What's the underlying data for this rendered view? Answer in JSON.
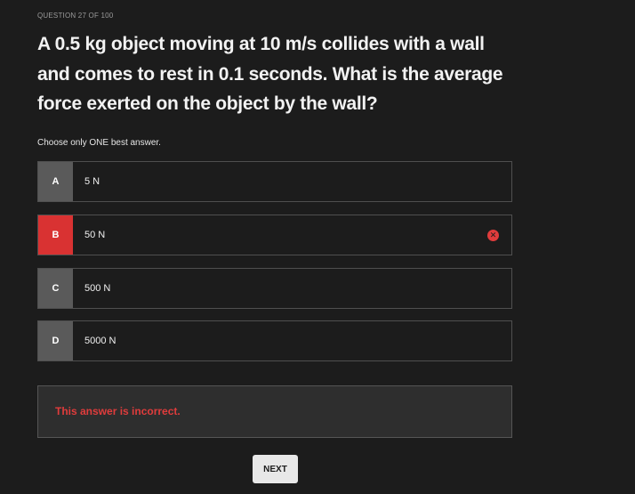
{
  "question": {
    "counter": "QUESTION 27 OF 100",
    "text": "A 0.5 kg object moving at 10 m/s collides with a wall and comes to rest in 0.1 seconds. What is the average force exerted on the object by the wall?",
    "instruction": "Choose only ONE best answer."
  },
  "options": [
    {
      "letter": "A",
      "text": "5 N"
    },
    {
      "letter": "B",
      "text": "50 N",
      "state": "selected-incorrect",
      "icon": "x-circle-icon"
    },
    {
      "letter": "C",
      "text": "500 N"
    },
    {
      "letter": "D",
      "text": "5000 N"
    }
  ],
  "feedback": {
    "text": "This answer is incorrect."
  },
  "next_button": {
    "label": "NEXT"
  },
  "colors": {
    "background": "#1c1c1c",
    "incorrect": "#d93232",
    "letter_box": "#5a5a5a",
    "feedback_bg": "#2e2e2e"
  }
}
